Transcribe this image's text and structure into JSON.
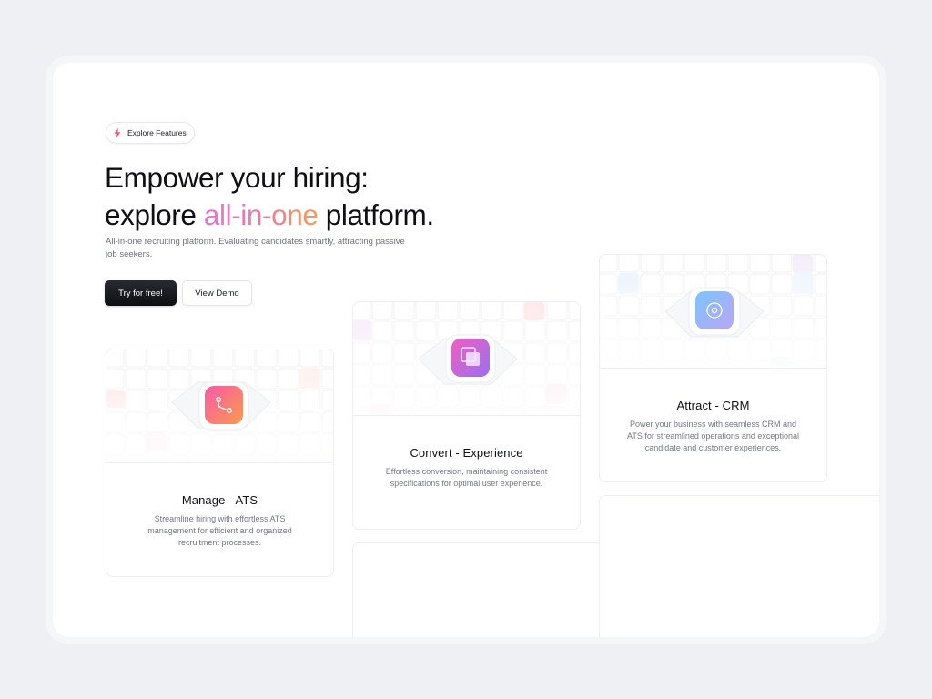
{
  "badge": {
    "label": "Explore Features",
    "icon": "lightning-icon"
  },
  "hero": {
    "line1": "Empower your hiring:",
    "line2_prefix": "explore ",
    "line2_highlight": "all-in-one",
    "line2_suffix": " platform.",
    "subtext": "All-in-one recruiting platform. Evaluating candidates smartly, attracting passive job seekers."
  },
  "buttons": {
    "primary": "Try for free!",
    "secondary": "View Demo"
  },
  "cards": [
    {
      "title": "Manage - ATS",
      "description": "Streamline hiring with effortless ATS management for efficient and organized recruitment processes.",
      "icon": "git-merge-icon",
      "accent": "#f7568f"
    },
    {
      "title": "Convert - Experience",
      "description": "Effortless conversion, maintaining consistent specifications for optimal user experience.",
      "icon": "copy-icon",
      "accent": "#c24ddf"
    },
    {
      "title": "Attract - CRM",
      "description": "Power your business with seamless CRM and ATS for streamlined operations and exceptional candidate and customer experiences.",
      "icon": "target-icon",
      "accent": "#6fb8f9"
    }
  ],
  "colors": {
    "background": "#eef0f4",
    "panel": "#ffffff",
    "highlight_start": "#e772d6",
    "highlight_end": "#f79a55"
  }
}
